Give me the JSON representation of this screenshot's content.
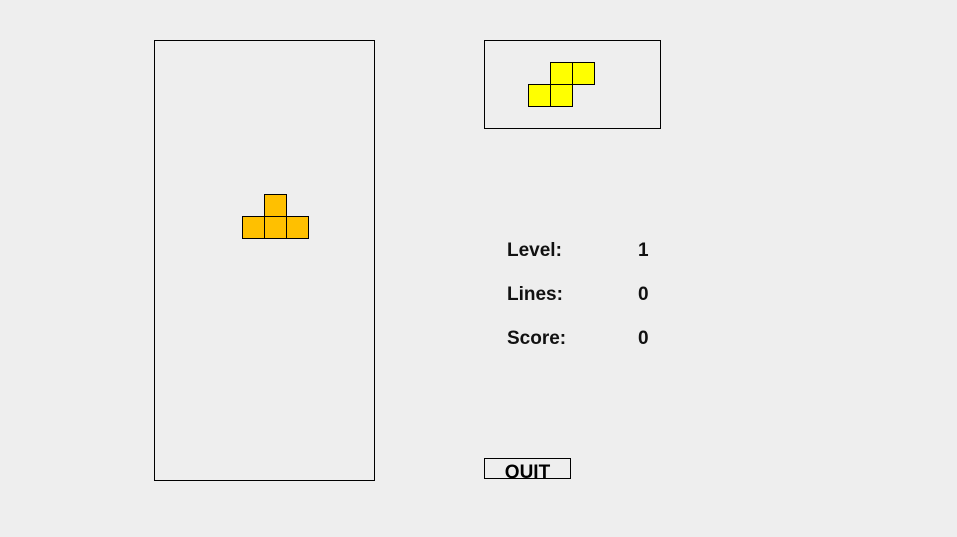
{
  "board": {
    "active_piece": {
      "shape": "T",
      "color": "#ffc000"
    }
  },
  "next_piece": {
    "shape": "S",
    "color": "#ffff00"
  },
  "stats": {
    "level_label": "Level:",
    "level_value": "1",
    "lines_label": "Lines:",
    "lines_value": "0",
    "score_label": "Score:",
    "score_value": "0"
  },
  "controls": {
    "quit_label": "QUIT"
  }
}
